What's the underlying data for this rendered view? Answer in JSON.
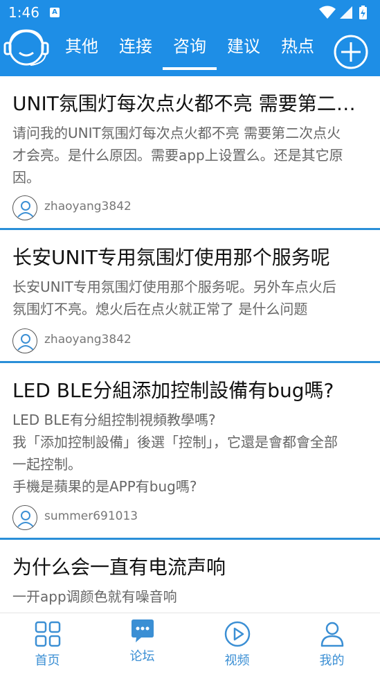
{
  "status": {
    "time": "1:46",
    "badge": "A"
  },
  "nav": {
    "tabs": [
      "其他",
      "连接",
      "咨询",
      "建议",
      "热点"
    ],
    "active_tab": "咨询"
  },
  "posts": [
    {
      "title": "UNIT氛围灯每次点火都不亮 需要第二次点火才会亮",
      "body": [
        "请问我的UNIT氛围灯每次点火都不亮 需要第二次点火",
        "才会亮。是什么原因。需要app上设置么。还是其它原",
        "因。"
      ],
      "user": "zhaoyang3842"
    },
    {
      "title": "长安UNIT专用氛围灯使用那个服务呢",
      "body": [
        "长安UNIT专用氛围灯使用那个服务呢。另外车点火后",
        "氛围灯不亮。熄火后在点火就正常了 是什么问题"
      ],
      "user": "zhaoyang3842"
    },
    {
      "title": "LED BLE分組添加控制設備有bug嗎?",
      "body": [
        "LED BLE有分組控制視頻教學嗎?",
        "我「添加控制設備」後選「控制」，它還是會都會全部",
        "一起控制。",
        "手機是蘋果的是APP有bug嗎?"
      ],
      "user": "summer691013"
    },
    {
      "title": "为什么会一直有电流声响",
      "body": [
        "一开app调颜色就有噪音响"
      ],
      "user": ""
    }
  ],
  "bottom_nav": {
    "items": [
      "首页",
      "论坛",
      "视频",
      "我的"
    ],
    "active": "论坛",
    "color": "#3b8fd4"
  },
  "colors": {
    "primary": "#1e8ee6",
    "divider": "#2a8fd8"
  }
}
